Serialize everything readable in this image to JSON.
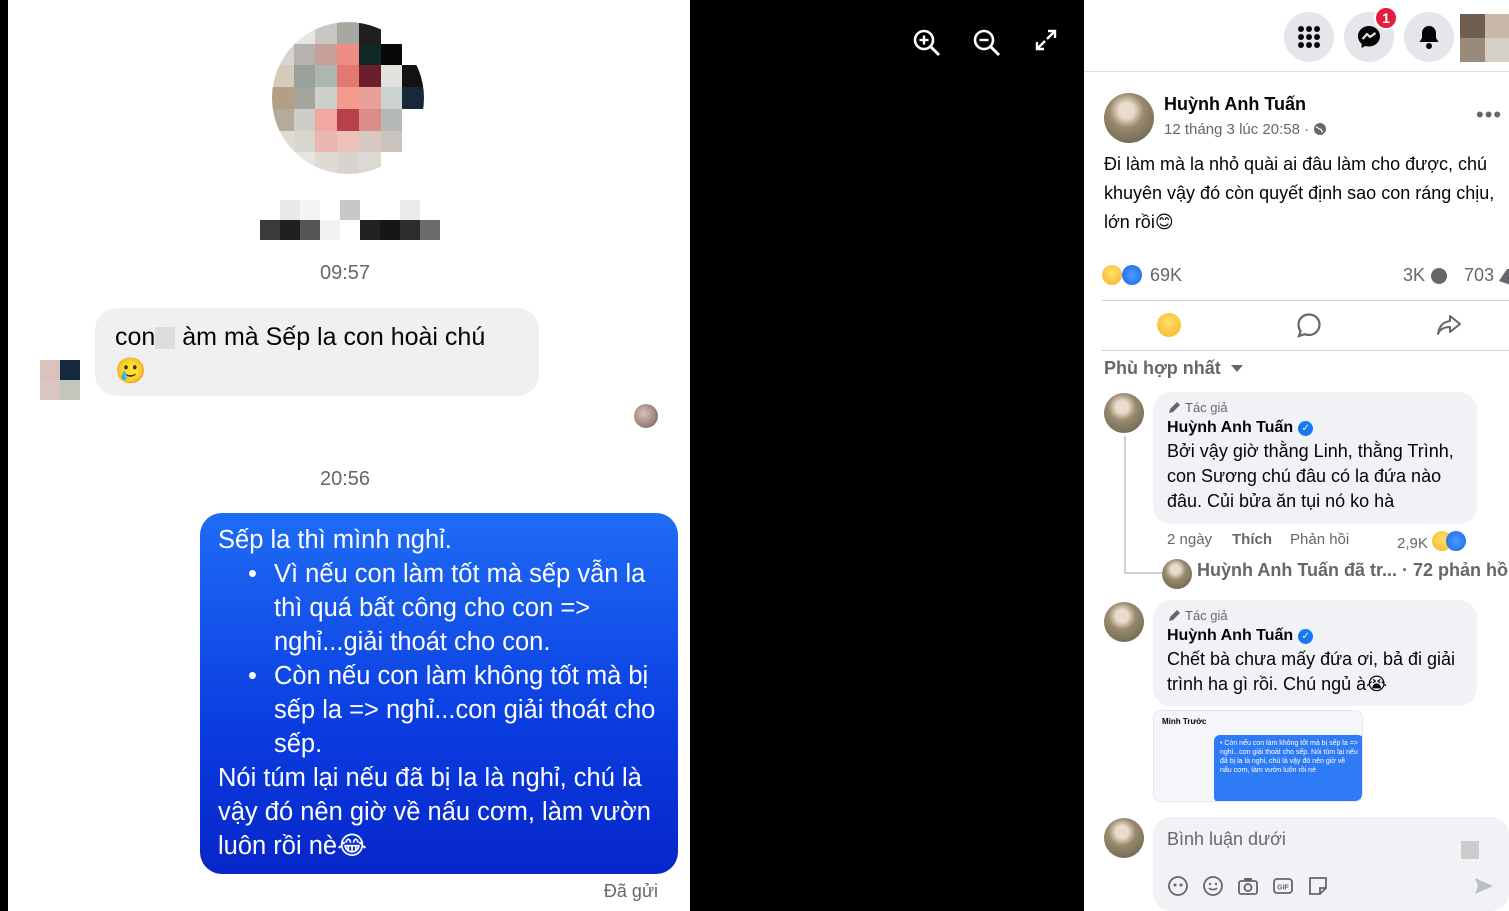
{
  "chat": {
    "time_1": "09:57",
    "incoming_text_a": "con",
    "incoming_text_b": "àm mà Sếp la con hoài chú",
    "incoming_emoji": "🥲",
    "time_2": "20:56",
    "outgoing": {
      "line1": "Sếp la thì mình nghỉ.",
      "bullets": [
        "Vì nếu con làm tốt mà sếp vẫn la thì quá bất công cho con => nghỉ...giải thoát cho con.",
        "Còn nếu con làm không tốt mà bị sếp la => nghỉ...con giải thoát cho sếp."
      ],
      "closing": "Nói túm lại nếu đã bị la là nghỉ, chú là vậy đó nên giờ về nấu cơm, làm vườn luôn rồi nè",
      "closing_emoji": "😂"
    },
    "sent_status": "Đã gửi"
  },
  "viewer": {
    "icons": [
      "zoom-in-icon",
      "zoom-out-icon",
      "fullscreen-icon"
    ]
  },
  "fb": {
    "messenger_badge": "1",
    "post": {
      "author": "Huỳnh Anh Tuấn",
      "meta": "12 tháng 3 lúc 20:58 ·",
      "text": "Đi làm mà la nhỏ quài ai đâu làm cho được, chú khuyên vậy đó còn quyết định sao con ráng chịu, lớn rồi",
      "text_emoji": "😊",
      "reactions": "69K",
      "comments_count": "3K",
      "shares_count": "703"
    },
    "sort_label": "Phù hợp nhất",
    "comments": [
      {
        "tag": "Tác giả",
        "name": "Huỳnh Anh Tuấn",
        "text": "Bởi vậy giờ thằng Linh, thằng Trình, con Sương chú đâu có la đứa nào đâu. Củi bửa ăn tụi nó ko hà",
        "age": "2 ngày",
        "like": "Thích",
        "reply": "Phản hồi",
        "reacts": "2,9K"
      },
      {
        "tag": "Tác giả",
        "name": "Huỳnh Anh Tuấn",
        "text": "Chết bà chưa mấy đứa ơi, bả đi giải trình ha gì rồi. Chú ngủ à",
        "emoji": "😭"
      }
    ],
    "replies_line": "Huỳnh Anh Tuấn đã tr... · 72 phản hồ",
    "thumb": {
      "header": "Minh Trước",
      "text": "• Còn nếu con làm không tốt mà bị sếp la => nghỉ...con giải thoát cho sếp. Nói túm lại nếu đã bị la là nghỉ, chú là vậy đó nên giờ về nấu cơm, làm vườn luôn rồi nè"
    },
    "composer_placeholder": "Bình luận dưới"
  },
  "colors": {
    "bubble_blue": "#1f6cf5",
    "fb_blue": "#1877f2",
    "badge_red": "#e41e3f"
  }
}
